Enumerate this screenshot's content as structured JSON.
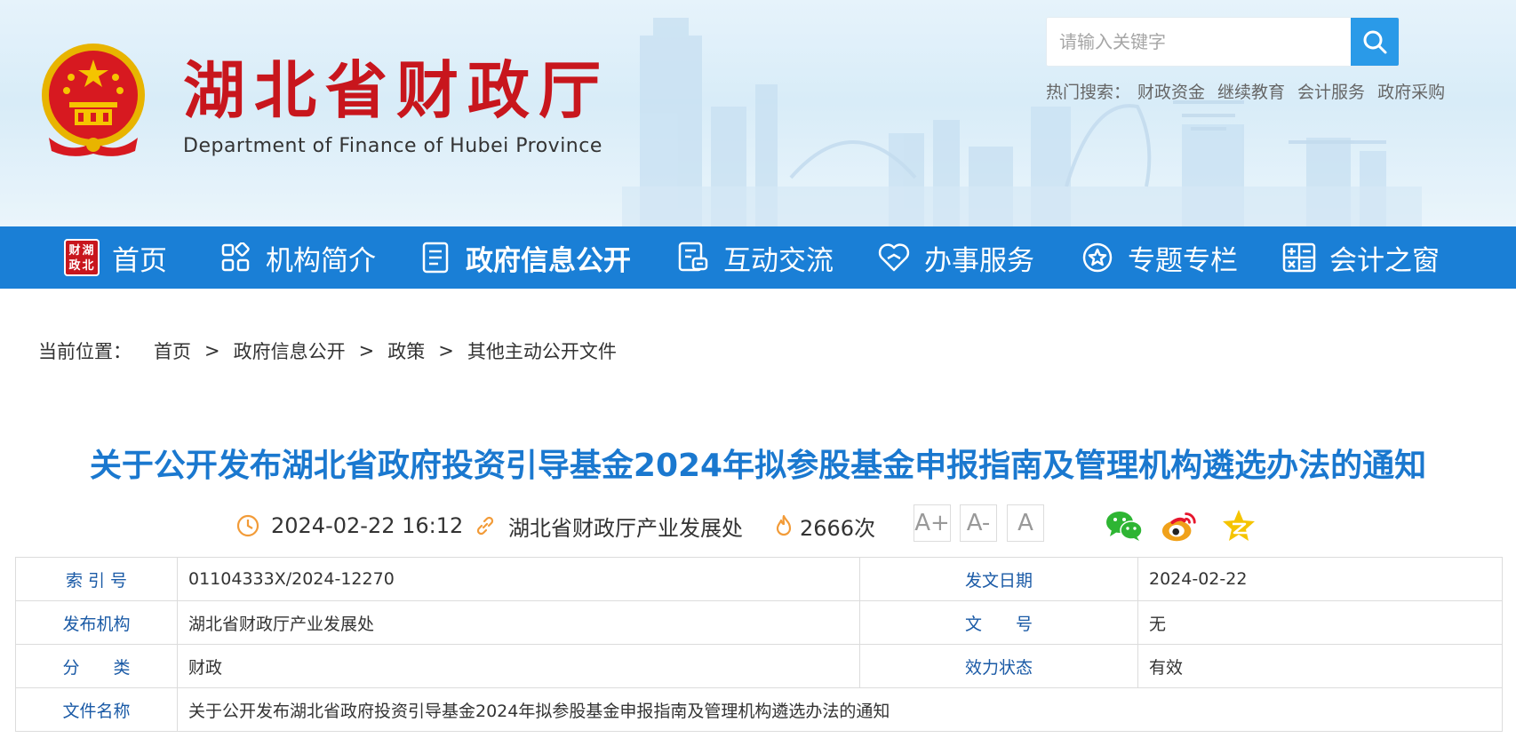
{
  "header": {
    "site_name": "湖北省财政厅",
    "site_name_en": "Department of Finance of Hubei Province",
    "emblem_icon": "national-emblem-icon",
    "search": {
      "placeholder": "请输入关键字",
      "icon": "search-icon"
    },
    "hot_search": {
      "label": "热门搜索：",
      "items": [
        "财政资金",
        "继续教育",
        "会计服务",
        "政府采购"
      ]
    }
  },
  "nav": {
    "items": [
      {
        "label": "首页",
        "icon": "hubei-finance-logo-icon",
        "logo_text": "湖北财政"
      },
      {
        "label": "机构简介",
        "icon": "grid-icon"
      },
      {
        "label": "政府信息公开",
        "icon": "document-icon",
        "active": true
      },
      {
        "label": "互动交流",
        "icon": "chat-document-icon"
      },
      {
        "label": "办事服务",
        "icon": "heart-icon"
      },
      {
        "label": "专题专栏",
        "icon": "star-circle-icon"
      },
      {
        "label": "会计之窗",
        "icon": "calculator-icon"
      }
    ]
  },
  "breadcrumb": {
    "label": "当前位置：",
    "separator": ">",
    "items": [
      "首页",
      "政府信息公开",
      "政策",
      "其他主动公开文件"
    ]
  },
  "article": {
    "title": "关于公开发布湖北省政府投资引导基金2024年拟参股基金申报指南及管理机构遴选办法的通知",
    "meta": {
      "datetime": "2024-02-22 16:12",
      "source": "湖北省财政厅产业发展处",
      "views": "2666次"
    },
    "font_size_buttons": [
      "A+",
      "A-",
      "A"
    ],
    "share": [
      "wechat-icon",
      "weibo-icon",
      "qzone-icon"
    ]
  },
  "info_table": {
    "rows": [
      {
        "k1": "索 引 号",
        "v1": "01104333X/2024-12270",
        "k2": "发文日期",
        "v2": "2024-02-22"
      },
      {
        "k1": "发布机构",
        "v1": "湖北省财政厅产业发展处",
        "k2": "文　　号",
        "v2": "无"
      },
      {
        "k1": "分　　类",
        "v1": "财政",
        "k2": "效力状态",
        "v2": "有效"
      }
    ],
    "file_name_label": "文件名称",
    "file_name": "关于公开发布湖北省政府投资引导基金2024年拟参股基金申报指南及管理机构遴选办法的通知"
  },
  "colors": {
    "brand_red": "#c8161d",
    "nav_blue": "#1a7fd6",
    "title_blue": "#1a78cf",
    "search_blue": "#2a9ae8"
  }
}
